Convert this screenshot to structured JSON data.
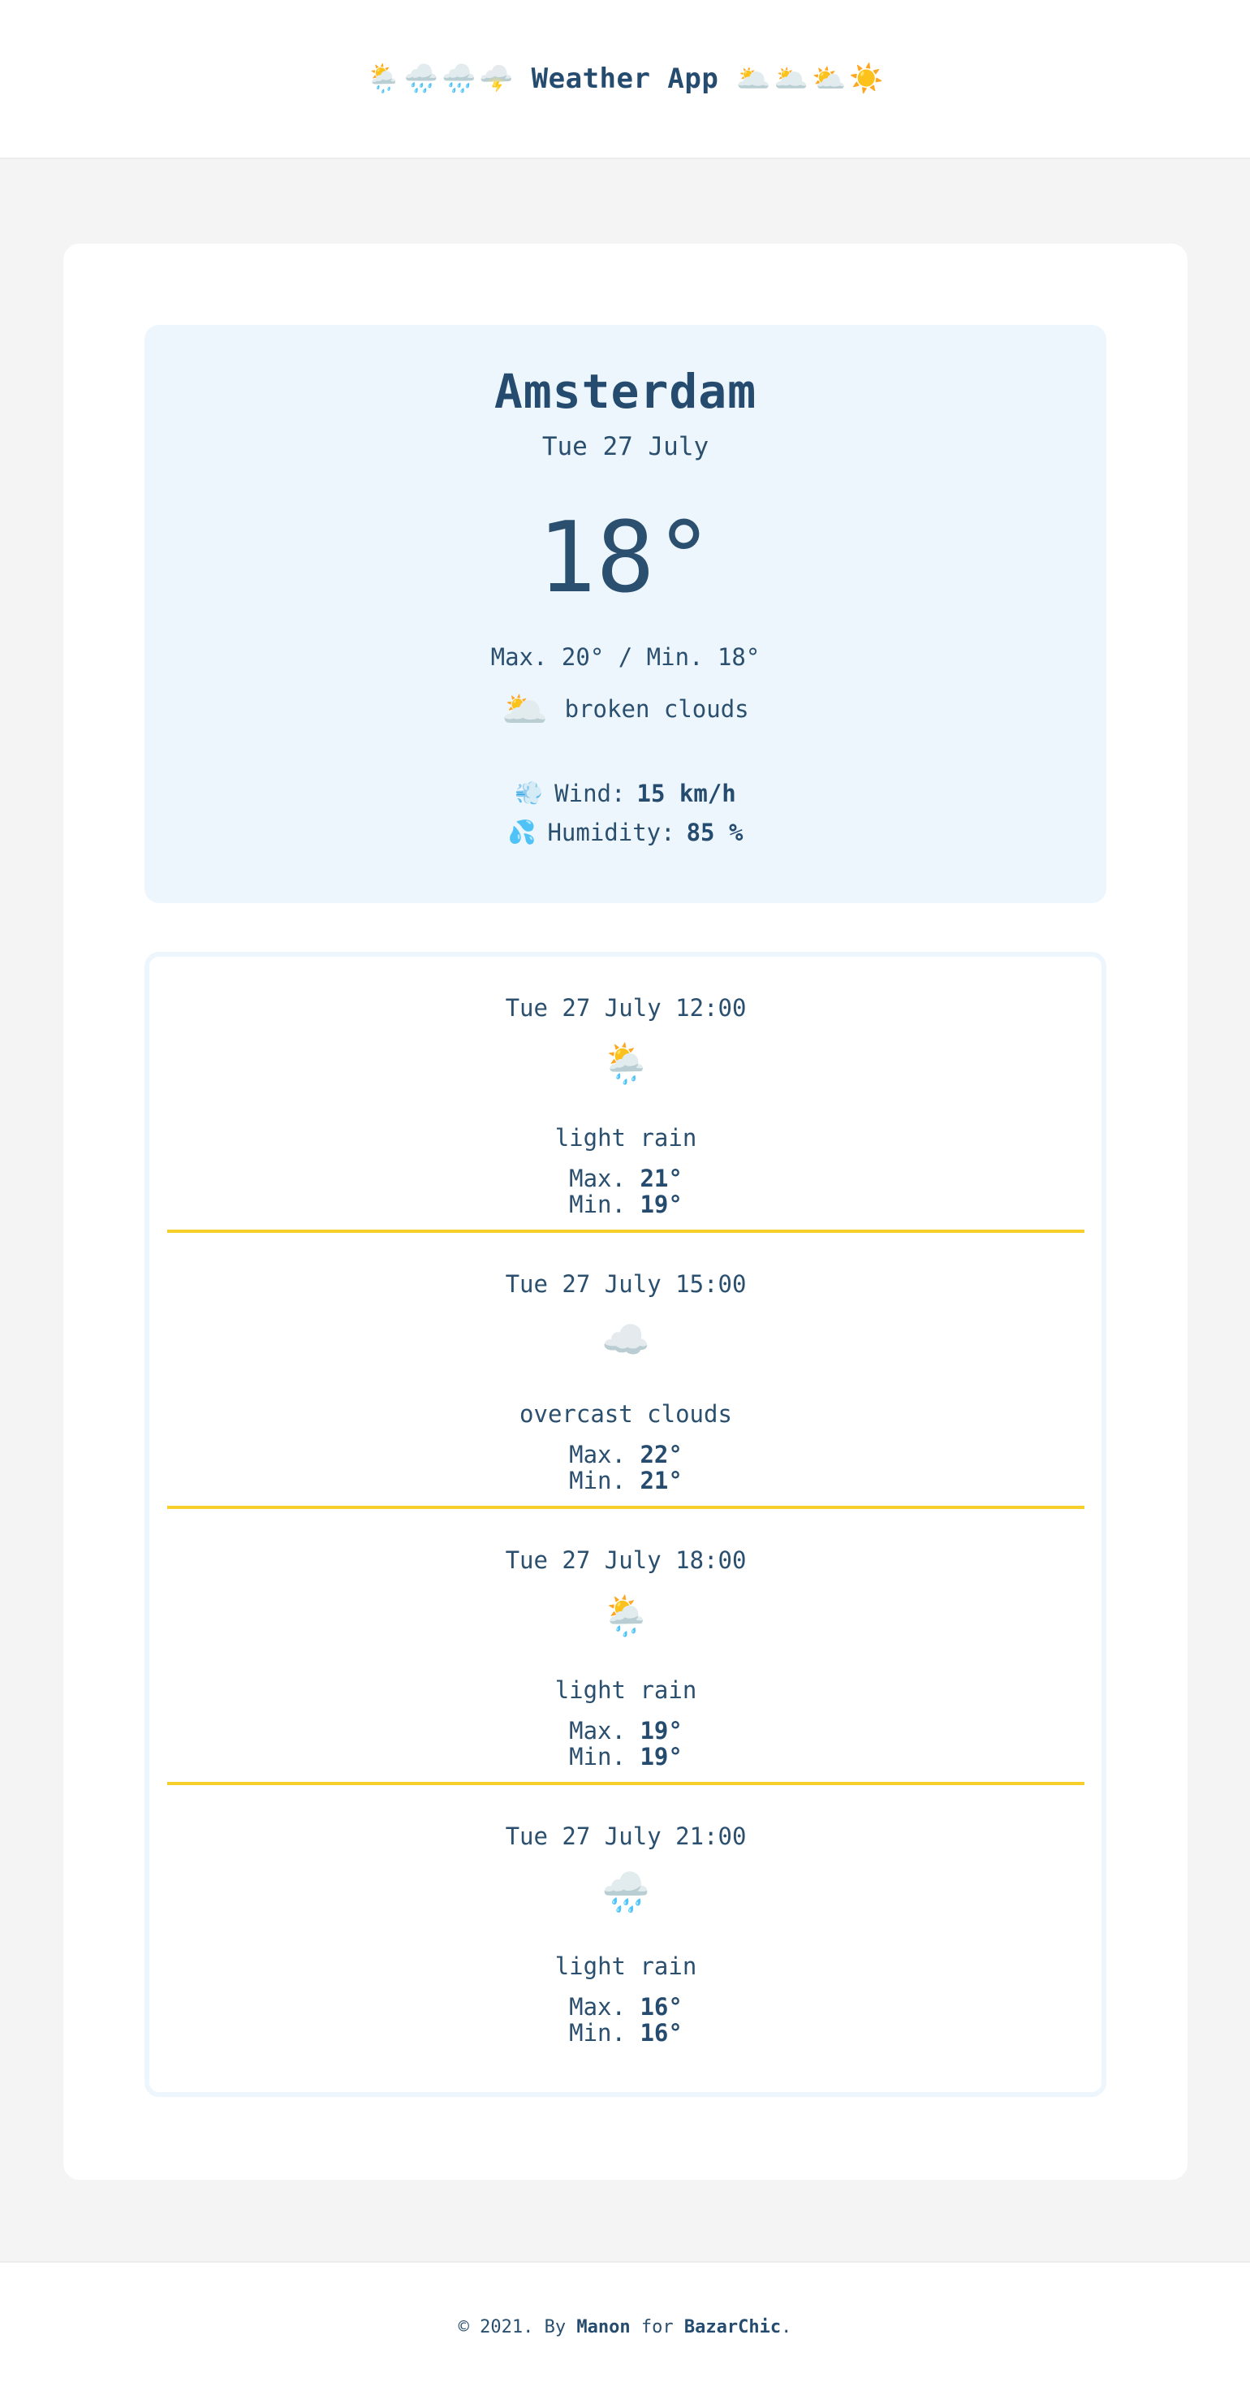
{
  "header": {
    "left_emojis": [
      "🌦️",
      "🌧️",
      "🌧️",
      "🌩️"
    ],
    "title": "Weather App",
    "right_emojis": [
      "🌥️",
      "🌥️",
      "⛅",
      "☀️"
    ]
  },
  "current": {
    "city": "Amsterdam",
    "date": "Tue 27 July",
    "temperature": "18°",
    "minmax": "Max. 20° / Min. 18°",
    "icon": "broken-clouds-icon",
    "icon_glyph": "🌥️",
    "description": "broken clouds",
    "wind_icon": "💨",
    "wind_label": "Wind:",
    "wind_value": "15 km/h",
    "humidity_icon": "💦",
    "humidity_label": "Humidity:",
    "humidity_value": "85 %"
  },
  "forecast": [
    {
      "datetime": "Tue 27 July 12:00",
      "icon": "light-rain-icon",
      "icon_glyph": "🌦️",
      "description": "light rain",
      "max_label": "Max.",
      "max": "21°",
      "min_label": "Min.",
      "min": "19°"
    },
    {
      "datetime": "Tue 27 July 15:00",
      "icon": "overcast-clouds-icon",
      "icon_glyph": "☁️",
      "description": "overcast clouds",
      "max_label": "Max.",
      "max": "22°",
      "min_label": "Min.",
      "min": "21°"
    },
    {
      "datetime": "Tue 27 July 18:00",
      "icon": "light-rain-icon",
      "icon_glyph": "🌦️",
      "description": "light rain",
      "max_label": "Max.",
      "max": "19°",
      "min_label": "Min.",
      "min": "19°"
    },
    {
      "datetime": "Tue 27 July 21:00",
      "icon": "light-rain-night-icon",
      "icon_glyph": "🌧️",
      "description": "light rain",
      "max_label": "Max.",
      "max": "16°",
      "min_label": "Min.",
      "min": "16°"
    }
  ],
  "footer": {
    "prefix": "© 2021. By",
    "author": "Manon",
    "middle": "for",
    "company": "BazarChic",
    "suffix": "."
  },
  "colors": {
    "primary_text": "#2b4f6e",
    "separator": "#f7cf2a",
    "current_bg": "#eef6fd",
    "page_bg": "#f4f4f4"
  }
}
